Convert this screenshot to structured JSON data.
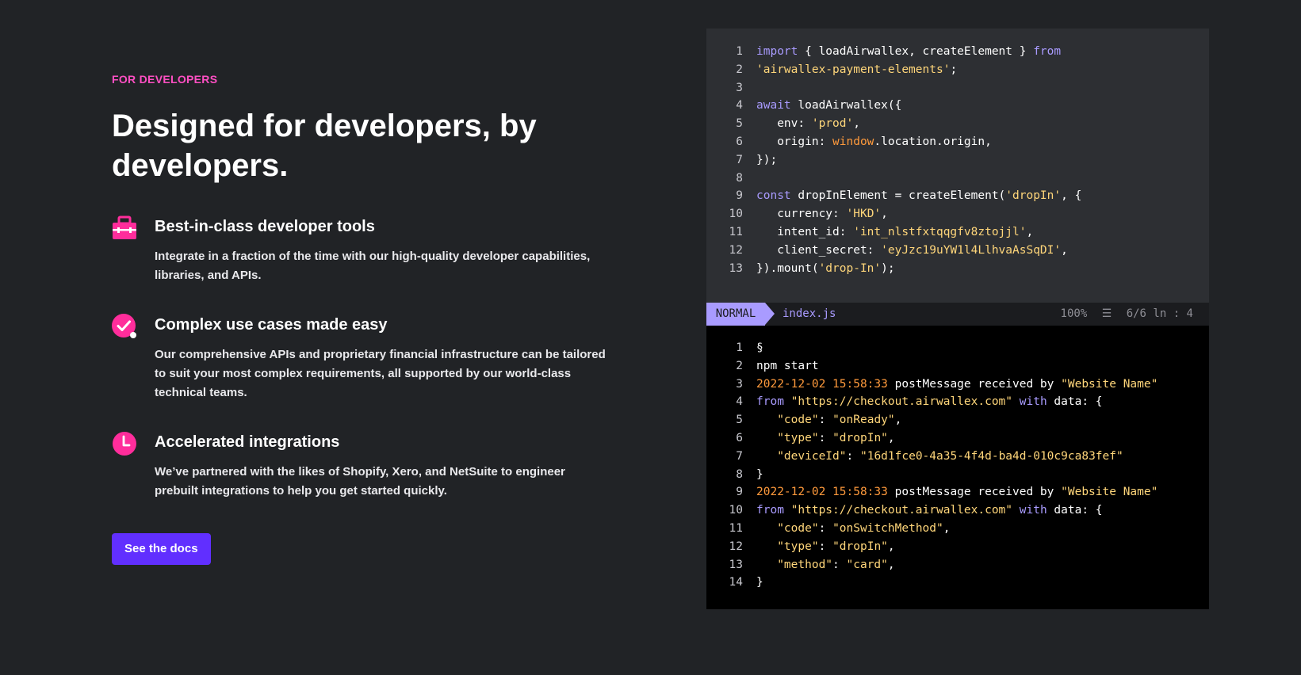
{
  "section": {
    "eyebrow": "FOR DEVELOPERS",
    "headline": "Designed for developers, by developers."
  },
  "features": [
    {
      "icon": "toolbox-icon",
      "title": "Best-in-class developer tools",
      "description": "Integrate in a fraction of the time with our high-quality developer capabilities, libraries, and APIs."
    },
    {
      "icon": "check-circle-icon",
      "title": "Complex use cases made easy",
      "description": "Our comprehensive APIs and proprietary financial infrastructure can be tailored to suit your most complex requirements, all supported by our world-class technical teams."
    },
    {
      "icon": "clock-icon",
      "title": "Accelerated integrations",
      "description": "We’ve partnered with the likes of Shopify, Xero, and NetSuite to engineer prebuilt integrations to help you get started quickly."
    }
  ],
  "cta": {
    "label": "See the docs"
  },
  "colors": {
    "accent_pink": "#ff2d9b",
    "button_purple": "#612fff",
    "keyword": "#a99bff",
    "string": "#ffd67a"
  },
  "editor": {
    "code_lines": [
      {
        "n": "1",
        "parts": [
          {
            "c": "k",
            "t": "import"
          },
          {
            "c": "",
            "t": " { loadAirwallex, createElement } "
          },
          {
            "c": "k",
            "t": "from"
          }
        ]
      },
      {
        "n": "2",
        "parts": [
          {
            "c": "s",
            "t": "'airwallex-payment-elements'"
          },
          {
            "c": "",
            "t": ";"
          }
        ]
      },
      {
        "n": "3",
        "parts": []
      },
      {
        "n": "4",
        "parts": [
          {
            "c": "k",
            "t": "await"
          },
          {
            "c": "",
            "t": " loadAirwallex({"
          }
        ]
      },
      {
        "n": "5",
        "parts": [
          {
            "c": "",
            "t": "   env: "
          },
          {
            "c": "s",
            "t": "'prod'"
          },
          {
            "c": "",
            "t": ","
          }
        ]
      },
      {
        "n": "6",
        "parts": [
          {
            "c": "",
            "t": "   origin: "
          },
          {
            "c": "w",
            "t": "window"
          },
          {
            "c": "",
            "t": ".location.origin,"
          }
        ]
      },
      {
        "n": "7",
        "parts": [
          {
            "c": "",
            "t": "});"
          }
        ]
      },
      {
        "n": "8",
        "parts": []
      },
      {
        "n": "9",
        "parts": [
          {
            "c": "k",
            "t": "const"
          },
          {
            "c": "",
            "t": " dropInElement = createElement("
          },
          {
            "c": "s",
            "t": "'dropIn'"
          },
          {
            "c": "",
            "t": ", {"
          }
        ]
      },
      {
        "n": "10",
        "parts": [
          {
            "c": "",
            "t": "   currency: "
          },
          {
            "c": "s",
            "t": "'HKD'"
          },
          {
            "c": "",
            "t": ","
          }
        ]
      },
      {
        "n": "11",
        "parts": [
          {
            "c": "",
            "t": "   intent_id: "
          },
          {
            "c": "s",
            "t": "'int_nlstfxtqqgfv8ztojjl'"
          },
          {
            "c": "",
            "t": ","
          }
        ]
      },
      {
        "n": "12",
        "parts": [
          {
            "c": "",
            "t": "   client_secret: "
          },
          {
            "c": "s",
            "t": "'eyJzc19uYW1l4LlhvaAsSqDI'"
          },
          {
            "c": "",
            "t": ","
          }
        ]
      },
      {
        "n": "13",
        "parts": [
          {
            "c": "",
            "t": "}).mount("
          },
          {
            "c": "s",
            "t": "'drop-In'"
          },
          {
            "c": "",
            "t": ");"
          }
        ]
      }
    ],
    "status": {
      "mode": "NORMAL",
      "file": "index.js",
      "zoom": "100%",
      "lines_icon": "☰",
      "position": "6/6 ln : 4"
    },
    "terminal_lines": [
      {
        "n": "1",
        "parts": [
          {
            "c": "",
            "t": "§"
          }
        ]
      },
      {
        "n": "2",
        "parts": [
          {
            "c": "",
            "t": "npm start"
          }
        ]
      },
      {
        "n": "3",
        "parts": [
          {
            "c": "t",
            "t": "2022-12-02 15:58:33"
          },
          {
            "c": "",
            "t": " postMessage received by "
          },
          {
            "c": "s",
            "t": "\"Website Name\""
          }
        ]
      },
      {
        "n": "4",
        "parts": [
          {
            "c": "k",
            "t": "from"
          },
          {
            "c": "",
            "t": " "
          },
          {
            "c": "s",
            "t": "\"https://checkout.airwallex.com\""
          },
          {
            "c": "",
            "t": " "
          },
          {
            "c": "k",
            "t": "with"
          },
          {
            "c": "",
            "t": " data: {"
          }
        ]
      },
      {
        "n": "5",
        "parts": [
          {
            "c": "",
            "t": "   "
          },
          {
            "c": "s",
            "t": "\"code\""
          },
          {
            "c": "",
            "t": ": "
          },
          {
            "c": "s",
            "t": "\"onReady\""
          },
          {
            "c": "",
            "t": ","
          }
        ]
      },
      {
        "n": "6",
        "parts": [
          {
            "c": "",
            "t": "   "
          },
          {
            "c": "s",
            "t": "\"type\""
          },
          {
            "c": "",
            "t": ": "
          },
          {
            "c": "s",
            "t": "\"dropIn\""
          },
          {
            "c": "",
            "t": ","
          }
        ]
      },
      {
        "n": "7",
        "parts": [
          {
            "c": "",
            "t": "   "
          },
          {
            "c": "s",
            "t": "\"deviceId\""
          },
          {
            "c": "",
            "t": ": "
          },
          {
            "c": "s",
            "t": "\"16d1fce0-4a35-4f4d-ba4d-010c9ca83fef\""
          }
        ]
      },
      {
        "n": "8",
        "parts": [
          {
            "c": "",
            "t": "}"
          }
        ]
      },
      {
        "n": "9",
        "parts": [
          {
            "c": "t",
            "t": "2022-12-02 15:58:33"
          },
          {
            "c": "",
            "t": " postMessage received by "
          },
          {
            "c": "s",
            "t": "\"Website Name\""
          }
        ]
      },
      {
        "n": "10",
        "parts": [
          {
            "c": "k",
            "t": "from"
          },
          {
            "c": "",
            "t": " "
          },
          {
            "c": "s",
            "t": "\"https://checkout.airwallex.com\""
          },
          {
            "c": "",
            "t": " "
          },
          {
            "c": "k",
            "t": "with"
          },
          {
            "c": "",
            "t": " data: {"
          }
        ]
      },
      {
        "n": "11",
        "parts": [
          {
            "c": "",
            "t": "   "
          },
          {
            "c": "s",
            "t": "\"code\""
          },
          {
            "c": "",
            "t": ": "
          },
          {
            "c": "s",
            "t": "\"onSwitchMethod\""
          },
          {
            "c": "",
            "t": ","
          }
        ]
      },
      {
        "n": "12",
        "parts": [
          {
            "c": "",
            "t": "   "
          },
          {
            "c": "s",
            "t": "\"type\""
          },
          {
            "c": "",
            "t": ": "
          },
          {
            "c": "s",
            "t": "\"dropIn\""
          },
          {
            "c": "",
            "t": ","
          }
        ]
      },
      {
        "n": "13",
        "parts": [
          {
            "c": "",
            "t": "   "
          },
          {
            "c": "s",
            "t": "\"method\""
          },
          {
            "c": "",
            "t": ": "
          },
          {
            "c": "s",
            "t": "\"card\""
          },
          {
            "c": "",
            "t": ","
          }
        ]
      },
      {
        "n": "14",
        "parts": [
          {
            "c": "",
            "t": "}"
          }
        ]
      }
    ]
  }
}
